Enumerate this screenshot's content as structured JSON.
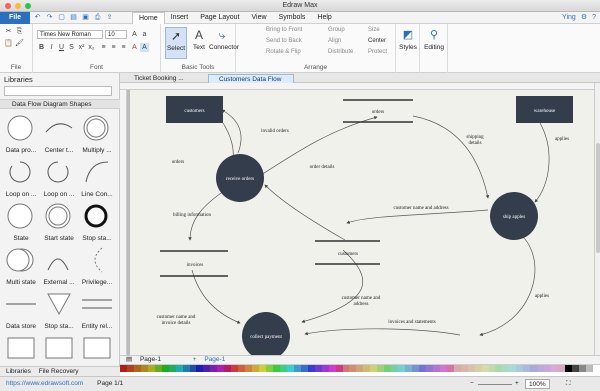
{
  "window": {
    "title": "Edraw Max"
  },
  "menubar": {
    "file": "File",
    "menus": [
      "Home",
      "Insert",
      "Page Layout",
      "View",
      "Symbols",
      "Help"
    ],
    "active_menu": "Home",
    "user": "Ying"
  },
  "ribbon": {
    "font_name": "Times New Roman",
    "font_size": "10",
    "groups": {
      "file": "File",
      "font": "Font",
      "basic_tools": "Basic Tools",
      "arrange": "Arrange"
    },
    "tools": {
      "select": "Select",
      "text": "Text",
      "connector": "Connector",
      "styles": "Styles",
      "editing": "Editing"
    },
    "arrange": {
      "bring_to_front": "Bring to Front",
      "send_to_back": "Send to Back",
      "rotate_flip": "Rotate & Flip",
      "group": "Group",
      "align": "Align",
      "distribute": "Distribute",
      "size": "Size",
      "center": "Center",
      "protect": "Protect"
    }
  },
  "tabs": [
    {
      "label": "Ticket Booking ..."
    },
    {
      "label": "Customers Data Flow"
    }
  ],
  "sidebar": {
    "title": "Libraries",
    "category": "Data Flow Diagram Shapes",
    "shapes": [
      {
        "label": "Data pro..."
      },
      {
        "label": "Center t..."
      },
      {
        "label": "Multiply ..."
      },
      {
        "label": "Loop on ..."
      },
      {
        "label": "Loop on ..."
      },
      {
        "label": "Line Con..."
      },
      {
        "label": "State"
      },
      {
        "label": "Start state"
      },
      {
        "label": "Stop sta..."
      },
      {
        "label": "Multi state"
      },
      {
        "label": "External ..."
      },
      {
        "label": "Privilege..."
      },
      {
        "label": "Data store"
      },
      {
        "label": "Stop sta..."
      },
      {
        "label": "Entity rel..."
      },
      {
        "label": ""
      },
      {
        "label": ""
      },
      {
        "label": ""
      }
    ],
    "bottom_tabs": [
      "Libraries",
      "File Recovery"
    ]
  },
  "diagram": {
    "entities": {
      "customers": "customers",
      "warehouse": "warehouse"
    },
    "processes": {
      "receive_orders": "receive orders",
      "ship_apples": "ship apples",
      "collect_payment": "collect payment"
    },
    "stores": {
      "orders": "orders",
      "customers": "customers",
      "invoices": "invoices"
    },
    "flows": {
      "invalid_orders": "invalid orders",
      "orders": "orders",
      "order_details": "order details",
      "shipping_details_1": "shipping",
      "shipping_details_2": "details",
      "applies_top": "applies",
      "billing_information": "billing information",
      "customer_name_address": "customer name and address",
      "customer_name_2a": "customer name and",
      "customer_name_2b": "address",
      "customer_invoice_1": "customer name and",
      "customer_invoice_2": "invoice details",
      "invoices_statements": "invoices and statements",
      "applies_bottom": "applies"
    }
  },
  "pagebar": {
    "page_tab": "Page-1",
    "current_page": "Page-1"
  },
  "status": {
    "url": "https://www.edrawsoft.com",
    "page": "Page 1/1",
    "zoom": "100%"
  },
  "colors": {
    "accent": "#2c6fbe",
    "node": "#333d4b",
    "canvas": "#f1f1ec"
  }
}
